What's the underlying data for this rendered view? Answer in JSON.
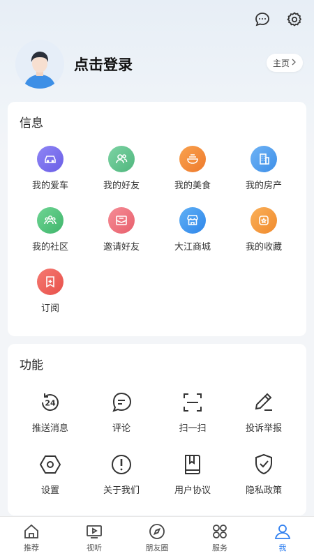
{
  "header": {
    "chat_icon": "chat-bubble-icon",
    "settings_icon": "gear-icon",
    "login_text": "点击登录",
    "home_label": "主页"
  },
  "info": {
    "title": "信息",
    "items": [
      {
        "label": "我的爱车",
        "icon": "car-icon",
        "color": "#7a6ff0"
      },
      {
        "label": "我的好友",
        "icon": "friends-icon",
        "color": "#5cc08a"
      },
      {
        "label": "我的美食",
        "icon": "food-bowl-icon",
        "color": "#f28a3a"
      },
      {
        "label": "我的房产",
        "icon": "building-icon",
        "color": "#4a9cf0"
      },
      {
        "label": "我的社区",
        "icon": "community-icon",
        "color": "#4cc27a"
      },
      {
        "label": "邀请好友",
        "icon": "invite-envelope-icon",
        "color": "#f0707e"
      },
      {
        "label": "大江商城",
        "icon": "store-icon",
        "color": "#3a9cf0"
      },
      {
        "label": "我的收藏",
        "icon": "favorite-icon",
        "color": "#f59a3a"
      },
      {
        "label": "订阅",
        "icon": "subscribe-icon",
        "color": "#f2605e"
      }
    ]
  },
  "func": {
    "title": "功能",
    "items": [
      {
        "label": "推送消息",
        "icon": "push-24-icon"
      },
      {
        "label": "评论",
        "icon": "comment-icon"
      },
      {
        "label": "扫一扫",
        "icon": "scan-icon"
      },
      {
        "label": "投诉举报",
        "icon": "pen-report-icon"
      },
      {
        "label": "设置",
        "icon": "hexagon-settings-icon"
      },
      {
        "label": "关于我们",
        "icon": "info-exclamation-icon"
      },
      {
        "label": "用户协议",
        "icon": "document-icon"
      },
      {
        "label": "隐私政策",
        "icon": "shield-check-icon"
      }
    ]
  },
  "tabbar": {
    "active_color": "#2f7ff0",
    "tabs": [
      {
        "label": "推荐",
        "icon": "home-icon"
      },
      {
        "label": "视听",
        "icon": "tv-play-icon"
      },
      {
        "label": "朋友圈",
        "icon": "compass-icon"
      },
      {
        "label": "服务",
        "icon": "services-grid-icon"
      },
      {
        "label": "我",
        "icon": "user-icon",
        "active": true
      }
    ]
  }
}
